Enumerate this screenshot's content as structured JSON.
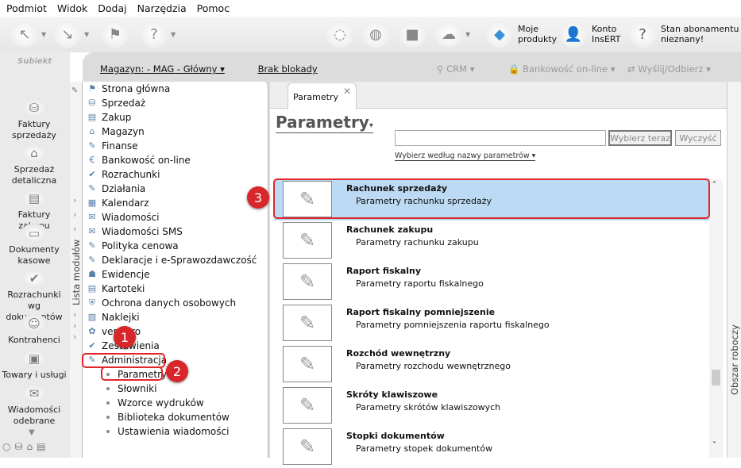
{
  "menu": [
    "Podmiot",
    "Widok",
    "Dodaj",
    "Narzędzia",
    "Pomoc"
  ],
  "toolbar": {
    "moje_produkty": "Moje produkty",
    "konto_insert": "Konto InsERT",
    "abonament": "Stan abonamentu nieznany!"
  },
  "header": {
    "magazyn": "Magazyn: - MAG - Główny",
    "blokada": "Brak blokady",
    "crm": "CRM",
    "bankowosc": "Bankowość on-line",
    "wyslij": "Wyślij/Odbierz"
  },
  "logo": "Subiekt",
  "sidebar": [
    "Faktury sprzedaży",
    "Sprzedaż detaliczna",
    "Faktury zakupu",
    "Dokumenty kasowe",
    "Rozrachunki wg dokumentów",
    "Kontrahenci",
    "Towary i usługi",
    "Wiadomości odebrane"
  ],
  "modules_label": "Lista modułów",
  "modules": [
    "Strona główna",
    "Sprzedaż",
    "Zakup",
    "Magazyn",
    "Finanse",
    "Bankowość on-line",
    "Rozrachunki",
    "Działania",
    "Kalendarz",
    "Wiadomości",
    "Wiadomości SMS",
    "Polityka cenowa",
    "Deklaracje i e-Sprawozdawczość",
    "Ewidencje",
    "Kartoteki",
    "Ochrona danych osobowych",
    "Naklejki",
    "vendero",
    "Zestawienia",
    "Administracja"
  ],
  "admin_sub": [
    "Parametry",
    "Słowniki",
    "Wzorce wydruków",
    "Biblioteka dokumentów",
    "Ustawienia wiadomości"
  ],
  "tab": "Parametry",
  "page_title": "Parametry",
  "search": {
    "value": "",
    "select_btn": "Wybierz teraz",
    "clear_btn": "Wyczyść",
    "by_name": "Wybierz według nazwy parametrów"
  },
  "params": [
    {
      "title": "Rachunek sprzedaży",
      "sub": "Parametry rachunku sprzedaży",
      "selected": true
    },
    {
      "title": "Rachunek zakupu",
      "sub": "Parametry rachunku zakupu"
    },
    {
      "title": "Raport fiskalny",
      "sub": "Parametry raportu fiskalnego"
    },
    {
      "title": "Raport fiskalny pomniejszenie",
      "sub": "Parametry pomniejszenia raportu fiskalnego"
    },
    {
      "title": "Rozchód wewnętrzny",
      "sub": "Parametry rozchodu wewnętrznego"
    },
    {
      "title": "Skróty klawiszowe",
      "sub": "Parametry skrótów klawiszowych"
    },
    {
      "title": "Stopki dokumentów",
      "sub": "Parametry stopek dokumentów"
    }
  ],
  "workspace_label": "Obszar roboczy",
  "badges": [
    "1",
    "2",
    "3"
  ],
  "colors": {
    "selected_row": "#bcdaf3",
    "highlight": "#e0262b"
  }
}
